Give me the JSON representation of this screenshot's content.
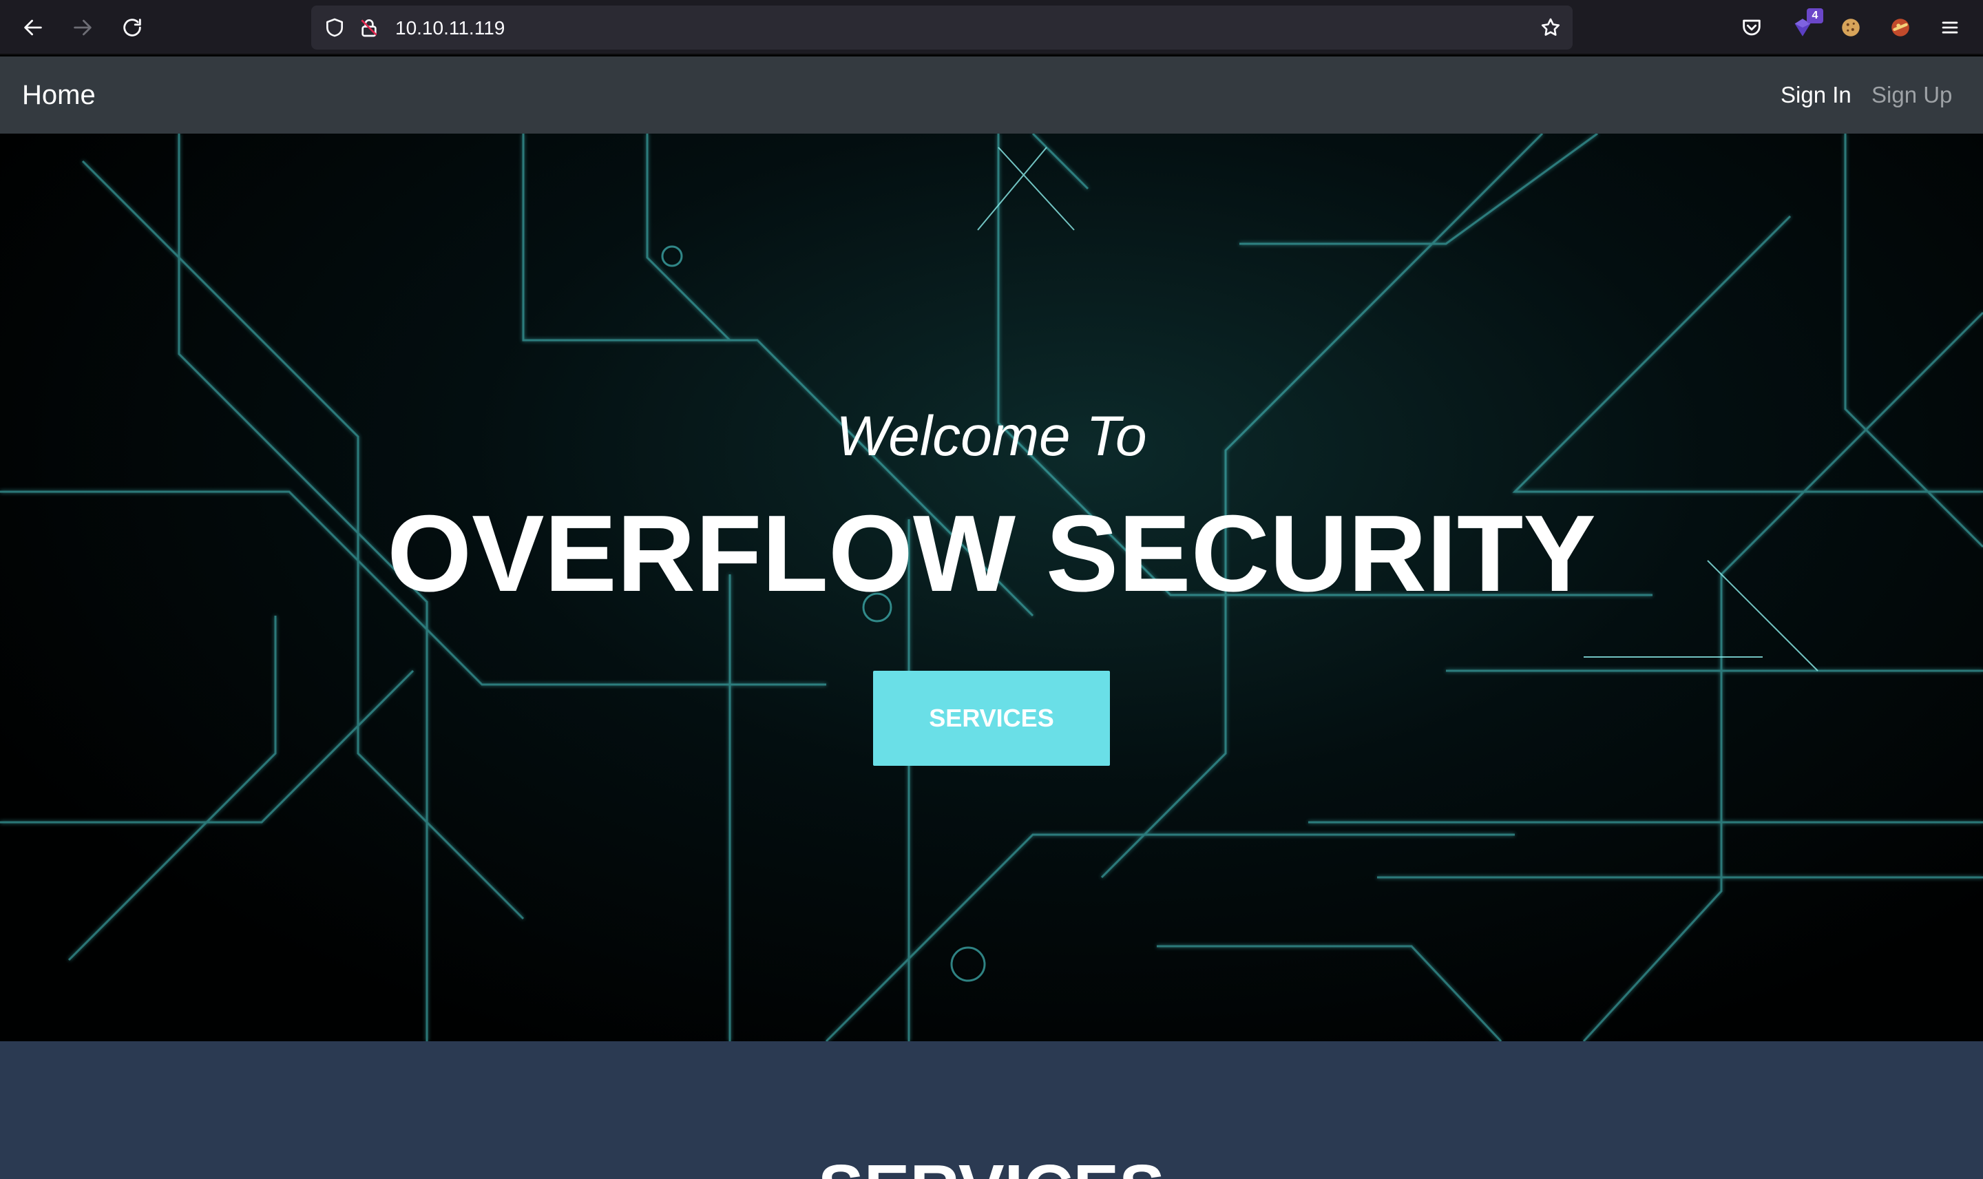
{
  "browser": {
    "url": "10.10.11.119",
    "extension_badge": "4",
    "icons": {
      "back": "arrow-left-icon",
      "forward": "arrow-right-icon",
      "reload": "reload-icon",
      "shield": "shield-icon",
      "lock": "lock-icon",
      "bookmark": "star-icon",
      "pocket": "pocket-icon",
      "extension": "extension-icon",
      "cookie": "cookie-icon",
      "addon": "addon-icon",
      "menu": "hamburger-menu-icon"
    }
  },
  "navbar": {
    "brand": "Home",
    "sign_in": "Sign In",
    "sign_up": "Sign Up"
  },
  "hero": {
    "welcome": "Welcome To",
    "title": "OVERFLOW SECURITY",
    "button_label": "SERVICES"
  },
  "services": {
    "heading": "SERVICES"
  },
  "colors": {
    "navbar_bg": "#343a40",
    "button_accent": "#6adfe7",
    "services_bg": "#2b3a52",
    "circuit_line": "#4fd6d6"
  }
}
